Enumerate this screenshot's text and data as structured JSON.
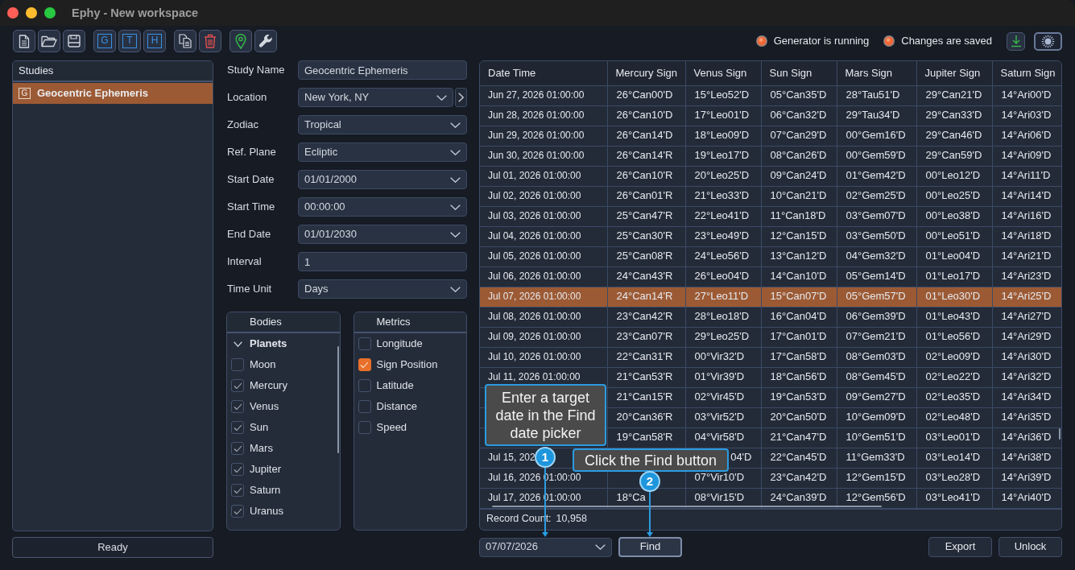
{
  "window": {
    "title": "Ephy - New workspace"
  },
  "toolbar": {
    "groups": [
      [
        {
          "kind": "document"
        },
        {
          "kind": "folder"
        },
        {
          "kind": "save"
        }
      ],
      [
        {
          "kind": "letter",
          "label": "G"
        },
        {
          "kind": "letter",
          "label": "T"
        },
        {
          "kind": "letter",
          "label": "H"
        }
      ],
      [
        {
          "kind": "copy"
        },
        {
          "kind": "delete"
        }
      ],
      [
        {
          "kind": "location"
        },
        {
          "kind": "tools"
        }
      ]
    ],
    "indicators": [
      {
        "label": "Generator is running",
        "on": true
      },
      {
        "label": "Changes are saved",
        "on": true
      }
    ],
    "actions": [
      {
        "kind": "download"
      },
      {
        "kind": "theme"
      }
    ]
  },
  "studies": {
    "title": "Studies",
    "items": [
      {
        "type_letter": "G",
        "label": "Geocentric Ephemeris",
        "selected": true
      }
    ]
  },
  "status_bar": {
    "text": "Ready"
  },
  "form": {
    "fields": [
      {
        "label": "Study Name",
        "kind": "text",
        "value": "Geocentric Ephemeris"
      },
      {
        "label": "Location",
        "kind": "dropdown_with_button",
        "value": "New York, NY"
      },
      {
        "label": "Zodiac",
        "kind": "dropdown",
        "value": "Tropical"
      },
      {
        "label": "Ref. Plane",
        "kind": "dropdown",
        "value": "Ecliptic"
      },
      {
        "label": "Start Date",
        "kind": "dropdown",
        "value": "01/01/2000"
      },
      {
        "label": "Start Time",
        "kind": "dropdown",
        "value": "00:00:00"
      },
      {
        "label": "End Date",
        "kind": "dropdown",
        "value": "01/01/2030"
      },
      {
        "label": "Interval",
        "kind": "text",
        "value": "1"
      },
      {
        "label": "Time Unit",
        "kind": "dropdown",
        "value": "Days"
      }
    ]
  },
  "bodies": {
    "title": "Bodies",
    "tree": [
      {
        "label": "Planets",
        "expanded": true,
        "children": [
          {
            "label": "Moon",
            "checked": false
          },
          {
            "label": "Mercury",
            "checked": true
          },
          {
            "label": "Venus",
            "checked": true
          },
          {
            "label": "Sun",
            "checked": true
          },
          {
            "label": "Mars",
            "checked": true
          },
          {
            "label": "Jupiter",
            "checked": true
          },
          {
            "label": "Saturn",
            "checked": true
          },
          {
            "label": "Uranus",
            "checked": true
          }
        ]
      }
    ]
  },
  "metrics": {
    "title": "Metrics",
    "items": [
      {
        "label": "Longitude",
        "checked": false
      },
      {
        "label": "Sign Position",
        "checked": true
      },
      {
        "label": "Latitude",
        "checked": false
      },
      {
        "label": "Distance",
        "checked": false
      },
      {
        "label": "Speed",
        "checked": false
      }
    ]
  },
  "table": {
    "columns": [
      "Date Time",
      "Mercury Sign",
      "Venus Sign",
      "Sun Sign",
      "Mars Sign",
      "Jupiter Sign",
      "Saturn Sign"
    ],
    "rows": [
      {
        "date_time": "Jun 27, 2026 01:00:00",
        "mercury": "26°Can00'D",
        "venus": "15°Leo52'D",
        "sun": "05°Can35'D",
        "mars": "28°Tau51'D",
        "jupiter": "29°Can21'D",
        "saturn": "14°Ari00'D",
        "selected": false
      },
      {
        "date_time": "Jun 28, 2026 01:00:00",
        "mercury": "26°Can10'D",
        "venus": "17°Leo01'D",
        "sun": "06°Can32'D",
        "mars": "29°Tau34'D",
        "jupiter": "29°Can33'D",
        "saturn": "14°Ari03'D",
        "selected": false
      },
      {
        "date_time": "Jun 29, 2026 01:00:00",
        "mercury": "26°Can14'D",
        "venus": "18°Leo09'D",
        "sun": "07°Can29'D",
        "mars": "00°Gem16'D",
        "jupiter": "29°Can46'D",
        "saturn": "14°Ari06'D",
        "selected": false
      },
      {
        "date_time": "Jun 30, 2026 01:00:00",
        "mercury": "26°Can14'R",
        "venus": "19°Leo17'D",
        "sun": "08°Can26'D",
        "mars": "00°Gem59'D",
        "jupiter": "29°Can59'D",
        "saturn": "14°Ari09'D",
        "selected": false
      },
      {
        "date_time": "Jul 01, 2026 01:00:00",
        "mercury": "26°Can10'R",
        "venus": "20°Leo25'D",
        "sun": "09°Can24'D",
        "mars": "01°Gem42'D",
        "jupiter": "00°Leo12'D",
        "saturn": "14°Ari11'D",
        "selected": false
      },
      {
        "date_time": "Jul 02, 2026 01:00:00",
        "mercury": "26°Can01'R",
        "venus": "21°Leo33'D",
        "sun": "10°Can21'D",
        "mars": "02°Gem25'D",
        "jupiter": "00°Leo25'D",
        "saturn": "14°Ari14'D",
        "selected": false
      },
      {
        "date_time": "Jul 03, 2026 01:00:00",
        "mercury": "25°Can47'R",
        "venus": "22°Leo41'D",
        "sun": "11°Can18'D",
        "mars": "03°Gem07'D",
        "jupiter": "00°Leo38'D",
        "saturn": "14°Ari16'D",
        "selected": false
      },
      {
        "date_time": "Jul 04, 2026 01:00:00",
        "mercury": "25°Can30'R",
        "venus": "23°Leo49'D",
        "sun": "12°Can15'D",
        "mars": "03°Gem50'D",
        "jupiter": "00°Leo51'D",
        "saturn": "14°Ari18'D",
        "selected": false
      },
      {
        "date_time": "Jul 05, 2026 01:00:00",
        "mercury": "25°Can08'R",
        "venus": "24°Leo56'D",
        "sun": "13°Can12'D",
        "mars": "04°Gem32'D",
        "jupiter": "01°Leo04'D",
        "saturn": "14°Ari21'D",
        "selected": false
      },
      {
        "date_time": "Jul 06, 2026 01:00:00",
        "mercury": "24°Can43'R",
        "venus": "26°Leo04'D",
        "sun": "14°Can10'D",
        "mars": "05°Gem14'D",
        "jupiter": "01°Leo17'D",
        "saturn": "14°Ari23'D",
        "selected": false
      },
      {
        "date_time": "Jul 07, 2026 01:00:00",
        "mercury": "24°Can14'R",
        "venus": "27°Leo11'D",
        "sun": "15°Can07'D",
        "mars": "05°Gem57'D",
        "jupiter": "01°Leo30'D",
        "saturn": "14°Ari25'D",
        "selected": true
      },
      {
        "date_time": "Jul 08, 2026 01:00:00",
        "mercury": "23°Can42'R",
        "venus": "28°Leo18'D",
        "sun": "16°Can04'D",
        "mars": "06°Gem39'D",
        "jupiter": "01°Leo43'D",
        "saturn": "14°Ari27'D",
        "selected": false
      },
      {
        "date_time": "Jul 09, 2026 01:00:00",
        "mercury": "23°Can07'R",
        "venus": "29°Leo25'D",
        "sun": "17°Can01'D",
        "mars": "07°Gem21'D",
        "jupiter": "01°Leo56'D",
        "saturn": "14°Ari29'D",
        "selected": false
      },
      {
        "date_time": "Jul 10, 2026 01:00:00",
        "mercury": "22°Can31'R",
        "venus": "00°Vir32'D",
        "sun": "17°Can58'D",
        "mars": "08°Gem03'D",
        "jupiter": "02°Leo09'D",
        "saturn": "14°Ari30'D",
        "selected": false
      },
      {
        "date_time": "Jul 11, 2026 01:00:00",
        "mercury": "21°Can53'R",
        "venus": "01°Vir39'D",
        "sun": "18°Can56'D",
        "mars": "08°Gem45'D",
        "jupiter": "02°Leo22'D",
        "saturn": "14°Ari32'D",
        "selected": false
      },
      {
        "mercury": "21°Can15'R",
        "venus": "02°Vir45'D",
        "sun": "19°Can53'D",
        "mars": "09°Gem27'D",
        "jupiter": "02°Leo35'D",
        "saturn": "14°Ari34'D",
        "selected": false
      },
      {
        "mercury": "20°Can36'R",
        "venus": "03°Vir52'D",
        "sun": "20°Can50'D",
        "mars": "10°Gem09'D",
        "jupiter": "02°Leo48'D",
        "saturn": "14°Ari35'D",
        "selected": false
      },
      {
        "mercury": "19°Can58'R",
        "venus": "04°Vir58'D",
        "sun": "21°Can47'D",
        "mars": "10°Gem51'D",
        "jupiter": "03°Leo01'D",
        "saturn": "14°Ari36'D",
        "selected": false
      },
      {
        "date_time": "Jul 15, 202",
        "venus": {
          "kind": "tail",
          "text": "04'D"
        },
        "sun": "22°Can45'D",
        "mars": "11°Gem33'D",
        "jupiter": "03°Leo14'D",
        "saturn": "14°Ari38'D",
        "selected": false
      },
      {
        "date_time": "Jul 16, 2026 01:00:00",
        "venus": "07°Vir10'D",
        "sun": "23°Can42'D",
        "mars": "12°Gem15'D",
        "jupiter": "03°Leo28'D",
        "saturn": "14°Ari39'D",
        "selected": false
      },
      {
        "date_time": "Jul 17, 2026 01:00:00",
        "mercury": "18°Ca",
        "venus": "08°Vir15'D",
        "sun": "24°Can39'D",
        "mars": "12°Gem56'D",
        "jupiter": "03°Leo41'D",
        "saturn": "14°Ari40'D",
        "selected": false
      }
    ],
    "record_count": {
      "label": "Record Count:",
      "value": "10,958"
    }
  },
  "find_bar": {
    "date_picker": {
      "value": "07/07/2026",
      "callout": {
        "number": "1",
        "text": "Enter a target date in the Find date picker"
      }
    },
    "find_button": {
      "label": "Find",
      "focused": true,
      "callout": {
        "number": "2",
        "text": "Click the Find button"
      }
    },
    "buttons": [
      "Export",
      "Unlock"
    ]
  }
}
